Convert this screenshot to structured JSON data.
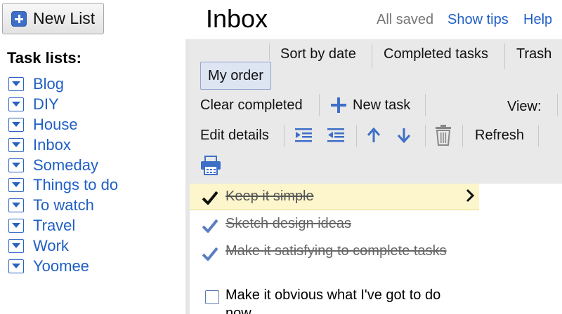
{
  "header": {
    "new_list_label": "New List",
    "title": "Inbox",
    "save_status": "All saved",
    "show_tips": "Show tips",
    "help": "Help"
  },
  "sidebar": {
    "heading": "Task lists:",
    "items": [
      "Blog",
      "DIY",
      "House",
      "Inbox",
      "Someday",
      "Things to do",
      "To watch",
      "Travel",
      "Work",
      "Yoomee"
    ]
  },
  "toolbar": {
    "sort_by_date": "Sort by date",
    "completed_tasks": "Completed tasks",
    "trash": "Trash",
    "my_order": "My order",
    "clear_completed": "Clear completed",
    "new_task": "New task",
    "view": "View:",
    "edit_details": "Edit details",
    "refresh": "Refresh"
  },
  "tasks": [
    {
      "text": "Keep it simple",
      "completed": true,
      "selected": true
    },
    {
      "text": "Sketch design ideas",
      "completed": true,
      "selected": false
    },
    {
      "text": "Make it satisfying to complete tasks",
      "completed": true,
      "selected": false
    },
    {
      "text": "Make it obvious what I've got to do now",
      "completed": false,
      "selected": false
    }
  ],
  "colors": {
    "link": "#1f5fc4",
    "selected_row": "#fdf6cc",
    "toolbar_bg": "#e9e9e9"
  }
}
